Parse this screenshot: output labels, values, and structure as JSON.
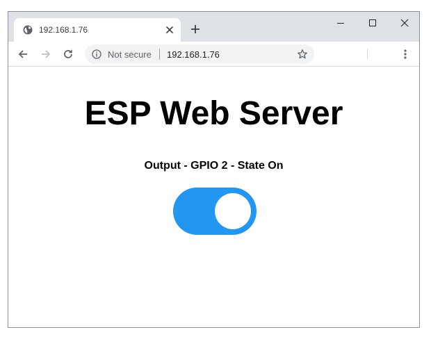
{
  "browser": {
    "tab": {
      "title": "192.168.1.76",
      "favicon": "globe-icon",
      "close_icon": "close-icon"
    },
    "new_tab_icon": "plus-icon",
    "window_controls": [
      "minimize-icon",
      "maximize-icon",
      "close-icon"
    ],
    "toolbar": {
      "back_icon": "back-arrow-icon",
      "forward_icon": "forward-arrow-icon",
      "reload_icon": "reload-icon",
      "security_text": "Not secure",
      "url": "192.168.1.76",
      "bookmark_icon": "star-icon",
      "menu_icon": "kebab-menu-icon"
    }
  },
  "page": {
    "heading": "ESP Web Server",
    "output_label": "Output - GPIO 2 - State On",
    "switch": {
      "checked": true,
      "color_on": "#2196f3"
    }
  }
}
